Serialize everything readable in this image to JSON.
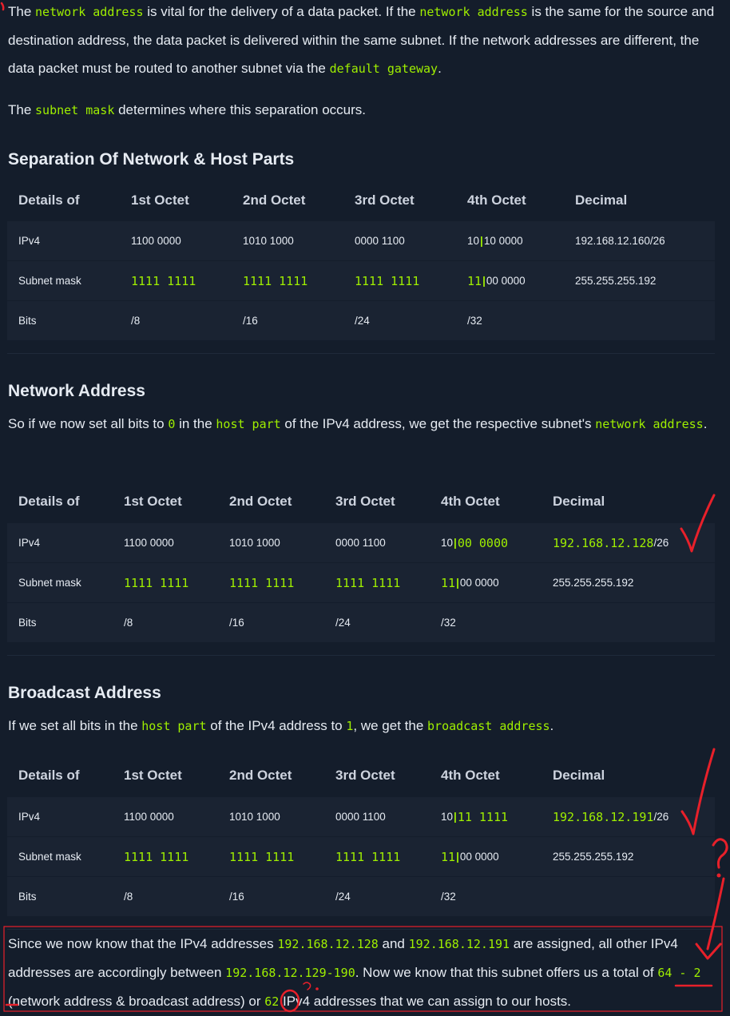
{
  "intro": {
    "p1": [
      {
        "t": "The "
      },
      {
        "c": "network address"
      },
      {
        "t": " is vital for the delivery of a data packet. If the "
      },
      {
        "c": "network address"
      },
      {
        "t": " is the same for the source and destination address, the data packet is delivered within the same subnet. If the network addresses are different, the data packet must be routed to another subnet via the "
      },
      {
        "c": "default gateway"
      },
      {
        "t": "."
      }
    ],
    "p2": [
      {
        "t": "The "
      },
      {
        "c": "subnet mask"
      },
      {
        "t": " determines where this separation occurs."
      }
    ]
  },
  "section1": {
    "title": "Separation Of Network & Host Parts",
    "headers": [
      "Details of",
      "1st Octet",
      "2nd Octet",
      "3rd Octet",
      "4th Octet",
      "Decimal"
    ],
    "rows": [
      [
        [
          {
            "t": "IPv4"
          }
        ],
        [
          {
            "t": "1100 0000"
          }
        ],
        [
          {
            "t": "1010 1000"
          }
        ],
        [
          {
            "t": "0000 1100"
          }
        ],
        [
          {
            "t": "10"
          },
          {
            "b": "|"
          },
          {
            "t": "10 0000"
          }
        ],
        [
          {
            "t": "192.168.12.160/26"
          }
        ]
      ],
      [
        [
          {
            "t": "Subnet mask"
          }
        ],
        [
          {
            "c": "1111 1111"
          }
        ],
        [
          {
            "c": "1111 1111"
          }
        ],
        [
          {
            "c": "1111 1111"
          }
        ],
        [
          {
            "c": "11"
          },
          {
            "b": "|"
          },
          {
            "t": "00 0000"
          }
        ],
        [
          {
            "t": "255.255.255.192"
          }
        ]
      ],
      [
        [
          {
            "t": "Bits"
          }
        ],
        [
          {
            "t": "/8"
          }
        ],
        [
          {
            "t": "/16"
          }
        ],
        [
          {
            "t": "/24"
          }
        ],
        [
          {
            "t": "/32"
          }
        ],
        []
      ]
    ]
  },
  "section2": {
    "title": "Network Address",
    "para": [
      {
        "t": "So if we now set all bits to "
      },
      {
        "c": "0"
      },
      {
        "t": " in the "
      },
      {
        "c": "host part"
      },
      {
        "t": " of the IPv4 address, we get the respective subnet's "
      },
      {
        "c": "network address"
      },
      {
        "t": "."
      }
    ],
    "headers": [
      "Details of",
      "1st Octet",
      "2nd Octet",
      "3rd Octet",
      "4th Octet",
      "Decimal"
    ],
    "rows": [
      [
        [
          {
            "t": "IPv4"
          }
        ],
        [
          {
            "t": "1100 0000"
          }
        ],
        [
          {
            "t": "1010 1000"
          }
        ],
        [
          {
            "t": "0000 1100"
          }
        ],
        [
          {
            "t": "10"
          },
          {
            "b": "|"
          },
          {
            "c": "00 0000"
          }
        ],
        [
          {
            "c": "192.168.12.128"
          },
          {
            "t": "/26"
          }
        ]
      ],
      [
        [
          {
            "t": "Subnet mask"
          }
        ],
        [
          {
            "c": "1111 1111"
          }
        ],
        [
          {
            "c": "1111 1111"
          }
        ],
        [
          {
            "c": "1111 1111"
          }
        ],
        [
          {
            "c": "11"
          },
          {
            "b": "|"
          },
          {
            "t": "00 0000"
          }
        ],
        [
          {
            "t": "255.255.255.192"
          }
        ]
      ],
      [
        [
          {
            "t": "Bits"
          }
        ],
        [
          {
            "t": "/8"
          }
        ],
        [
          {
            "t": "/16"
          }
        ],
        [
          {
            "t": "/24"
          }
        ],
        [
          {
            "t": "/32"
          }
        ],
        []
      ]
    ]
  },
  "section3": {
    "title": "Broadcast Address",
    "para": [
      {
        "t": "If we set all bits in the "
      },
      {
        "c": "host part"
      },
      {
        "t": " of the IPv4 address to "
      },
      {
        "c": "1"
      },
      {
        "t": ", we get the "
      },
      {
        "c": "broadcast address"
      },
      {
        "t": "."
      }
    ],
    "headers": [
      "Details of",
      "1st Octet",
      "2nd Octet",
      "3rd Octet",
      "4th Octet",
      "Decimal"
    ],
    "rows": [
      [
        [
          {
            "t": "IPv4"
          }
        ],
        [
          {
            "t": "1100 0000"
          }
        ],
        [
          {
            "t": "1010 1000"
          }
        ],
        [
          {
            "t": "0000 1100"
          }
        ],
        [
          {
            "t": "10"
          },
          {
            "b": "|"
          },
          {
            "c": "11 1111"
          }
        ],
        [
          {
            "c": "192.168.12.191"
          },
          {
            "t": "/26"
          }
        ]
      ],
      [
        [
          {
            "t": "Subnet mask"
          }
        ],
        [
          {
            "c": "1111 1111"
          }
        ],
        [
          {
            "c": "1111 1111"
          }
        ],
        [
          {
            "c": "1111 1111"
          }
        ],
        [
          {
            "c": "11"
          },
          {
            "b": "|"
          },
          {
            "t": "00 0000"
          }
        ],
        [
          {
            "t": "255.255.255.192"
          }
        ]
      ],
      [
        [
          {
            "t": "Bits"
          }
        ],
        [
          {
            "t": "/8"
          }
        ],
        [
          {
            "t": "/16"
          }
        ],
        [
          {
            "t": "/24"
          }
        ],
        [
          {
            "t": "/32"
          }
        ],
        []
      ]
    ]
  },
  "conclusion": [
    {
      "t": "Since we now know that the IPv4 addresses "
    },
    {
      "c": "192.168.12.128"
    },
    {
      "t": " and "
    },
    {
      "c": "192.168.12.191"
    },
    {
      "t": " are assigned, all other IPv4 addresses are accordingly between "
    },
    {
      "c": "192.168.12.129-190"
    },
    {
      "t": ". Now we know that this subnet offers us a total of "
    },
    {
      "c": "64 - 2"
    },
    {
      "t": " (network address & broadcast address) or "
    },
    {
      "c": "62"
    },
    {
      "t": " IPv4 addresses that we can assign to our hosts."
    }
  ],
  "colors": {
    "background": "#141d2b",
    "row": "#1a2332",
    "accent": "#9fef00",
    "annotation": "#e8202a"
  },
  "annotation_icons": [
    "checkmark-icon",
    "checkmark-icon",
    "question-mark-icon",
    "down-arrow-icon",
    "circle-mark-icon",
    "underline-mark-icon"
  ]
}
